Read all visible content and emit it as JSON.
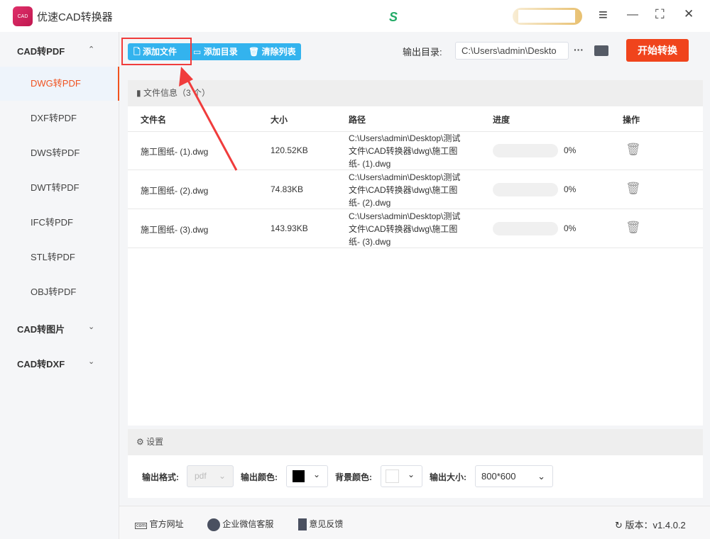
{
  "app": {
    "title": "优速CAD转换器",
    "logo_text": "CAD"
  },
  "window": {
    "menu": "≡",
    "minimize": "—",
    "maximize": "⛶",
    "close": "✕"
  },
  "sidebar": {
    "groups": [
      {
        "label": "CAD转PDF",
        "chevron": "^"
      },
      {
        "label": "CAD转图片",
        "chevron": "v"
      },
      {
        "label": "CAD转DXF",
        "chevron": "v"
      }
    ],
    "items": [
      "DWG转PDF",
      "DXF转PDF",
      "DWS转PDF",
      "DWT转PDF",
      "IFC转PDF",
      "STL转PDF",
      "OBJ转PDF"
    ]
  },
  "toolbar": {
    "add_file": "添加文件",
    "add_dir": "添加目录",
    "clear_list": "清除列表",
    "output_label": "输出目录:",
    "output_path": "C:\\Users\\admin\\Deskto",
    "more": "···",
    "start": "开始转换"
  },
  "files": {
    "header": "文件信息（3 个）",
    "columns": [
      "文件名",
      "大小",
      "路径",
      "进度",
      "操作"
    ],
    "rows": [
      {
        "name": "施工图纸- (1).dwg",
        "size": "120.52KB",
        "path": "C:\\Users\\admin\\Desktop\\测试文件\\CAD转换器\\dwg\\施工图纸- (1).dwg",
        "progress_text": "0%",
        "progress": 0
      },
      {
        "name": "施工图纸- (2).dwg",
        "size": "74.83KB",
        "path": "C:\\Users\\admin\\Desktop\\测试文件\\CAD转换器\\dwg\\施工图纸- (2).dwg",
        "progress_text": "0%",
        "progress": 0
      },
      {
        "name": "施工图纸- (3).dwg",
        "size": "143.93KB",
        "path": "C:\\Users\\admin\\Desktop\\测试文件\\CAD转换器\\dwg\\施工图纸- (3).dwg",
        "progress_text": "0%",
        "progress": 0
      }
    ]
  },
  "settings": {
    "header": "设置",
    "format_label": "输出格式:",
    "format_value": "pdf",
    "color_label": "输出颜色:",
    "output_color": "#000000",
    "bg_label": "背景颜色:",
    "bg_color": "#ffffff",
    "size_label": "输出大小:",
    "size_value": "800*600"
  },
  "footer": {
    "website": "官方网址",
    "wechat": "企业微信客服",
    "feedback": "意见反馈",
    "version": "版本：v1.4.0.2"
  },
  "colors": {
    "accent": "#f0521f",
    "primary": "#33b3ee",
    "annotation": "#f03c3c"
  }
}
